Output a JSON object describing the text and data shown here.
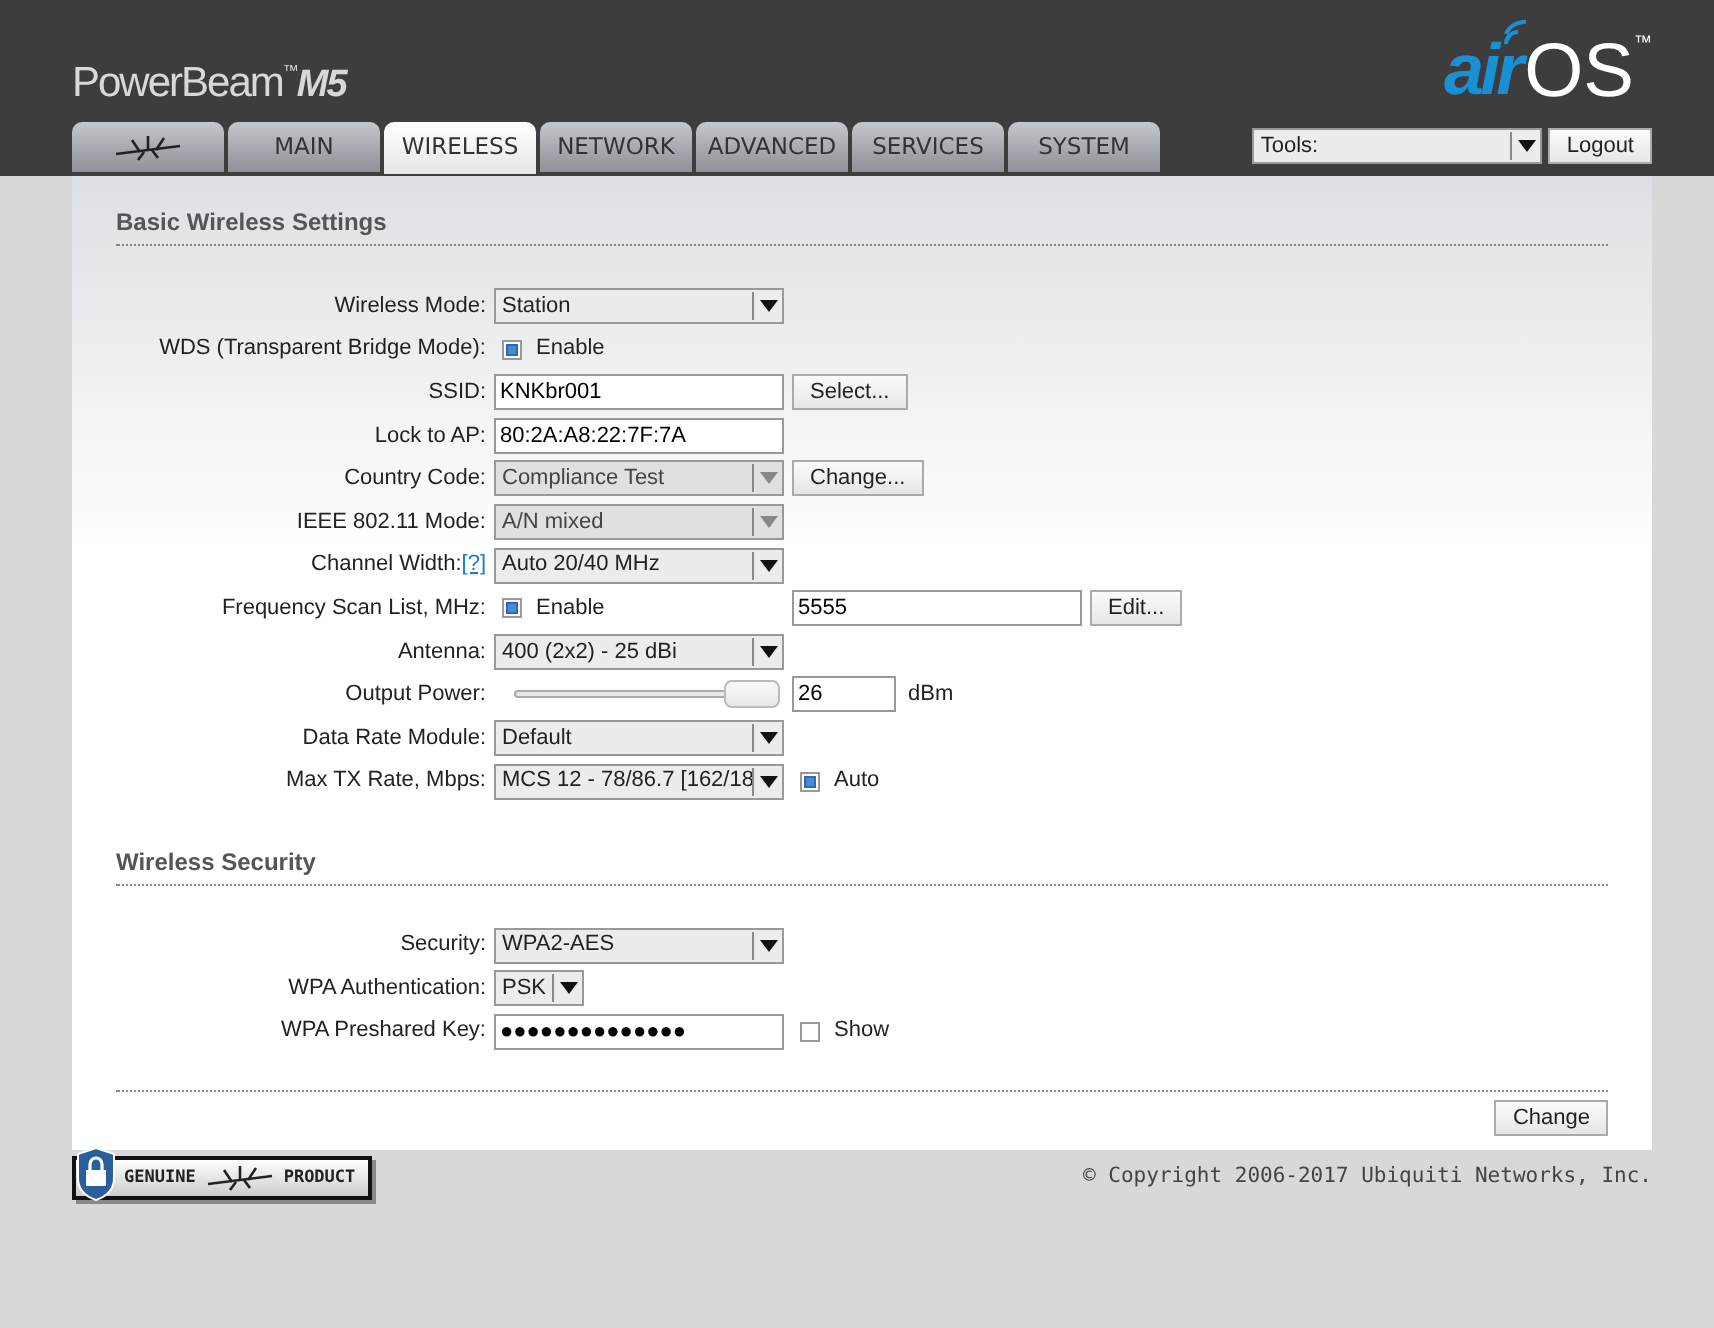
{
  "header": {
    "product": "PowerBeam",
    "trademark": "™",
    "model": "M5",
    "logo_air": "air",
    "logo_os": "OS",
    "logo_trademark": "™"
  },
  "tabs": [
    {
      "kind": "icon",
      "selected": false
    },
    {
      "kind": "text",
      "label": "MAIN",
      "selected": false
    },
    {
      "kind": "text",
      "label": "WIRELESS",
      "selected": true
    },
    {
      "kind": "text",
      "label": "NETWORK",
      "selected": false
    },
    {
      "kind": "text",
      "label": "ADVANCED",
      "selected": false
    },
    {
      "kind": "text",
      "label": "SERVICES",
      "selected": false
    },
    {
      "kind": "text",
      "label": "SYSTEM",
      "selected": false
    }
  ],
  "tools": {
    "value": "Tools:",
    "logout": "Logout"
  },
  "sections": [
    {
      "title": "Basic Wireless Settings",
      "fields": [
        {
          "label": "Wireless Mode:",
          "controls": [
            {
              "kind": "select",
              "value": "Station",
              "disabled": false
            }
          ]
        },
        {
          "label": "WDS (Transparent Bridge Mode):",
          "controls": [
            {
              "kind": "checkbox",
              "text": "Enable",
              "checked": true
            }
          ]
        },
        {
          "label": "SSID:",
          "controls": [
            {
              "kind": "text",
              "value": "KNKbr001"
            },
            {
              "kind": "button",
              "text": "Select..."
            }
          ]
        },
        {
          "label": "Lock to AP:",
          "controls": [
            {
              "kind": "text",
              "value": "80:2A:A8:22:7F:7A"
            }
          ]
        },
        {
          "label": "Country Code:",
          "controls": [
            {
              "kind": "select",
              "value": "Compliance Test",
              "disabled": true
            },
            {
              "kind": "button",
              "text": "Change..."
            }
          ]
        },
        {
          "label": "IEEE 802.11 Mode:",
          "controls": [
            {
              "kind": "select",
              "value": "A/N mixed",
              "disabled": true
            }
          ]
        },
        {
          "label": "Channel Width:",
          "help": "[?]",
          "controls": [
            {
              "kind": "select",
              "value": "Auto 20/40 MHz",
              "disabled": false
            }
          ]
        },
        {
          "label": "Frequency Scan List, MHz:",
          "controls": [
            {
              "kind": "checkbox",
              "text": "Enable",
              "checked": true
            },
            {
              "kind": "text",
              "value": "5555"
            },
            {
              "kind": "button",
              "text": "Edit..."
            }
          ]
        },
        {
          "label": "Antenna:",
          "controls": [
            {
              "kind": "select",
              "value": "400 (2x2) - 25 dBi",
              "disabled": false
            }
          ]
        },
        {
          "label": "Output Power:",
          "controls": [
            {
              "kind": "slider",
              "level": 1.0
            },
            {
              "kind": "short-text",
              "value": "26"
            },
            {
              "kind": "unit",
              "text": "dBm"
            }
          ]
        },
        {
          "label": "Data Rate Module:",
          "controls": [
            {
              "kind": "select",
              "value": "Default",
              "disabled": false
            }
          ]
        },
        {
          "label": "Max TX Rate, Mbps:",
          "controls": [
            {
              "kind": "select",
              "value": "MCS 12 - 78/86.7 [162/18",
              "disabled": false
            },
            {
              "kind": "checkbox",
              "text": "Auto",
              "checked": true
            }
          ]
        }
      ]
    },
    {
      "title": "Wireless Security",
      "fields": [
        {
          "label": "Security:",
          "controls": [
            {
              "kind": "select",
              "value": "WPA2-AES",
              "disabled": false
            }
          ]
        },
        {
          "label": "WPA Authentication:",
          "controls": [
            {
              "kind": "compact-select",
              "value": "PSK",
              "disabled": false
            }
          ]
        },
        {
          "label": "WPA Preshared Key:",
          "controls": [
            {
              "kind": "text",
              "value": "●●●●●●●●●●●●●●"
            },
            {
              "kind": "checkbox",
              "text": "Show",
              "checked": false
            }
          ]
        }
      ]
    }
  ],
  "submit": "Change",
  "footer": {
    "badge_left": "GENUINE",
    "badge_right": "PRODUCT",
    "copyright": "© Copyright 2006-2017 Ubiquiti Networks, Inc."
  }
}
